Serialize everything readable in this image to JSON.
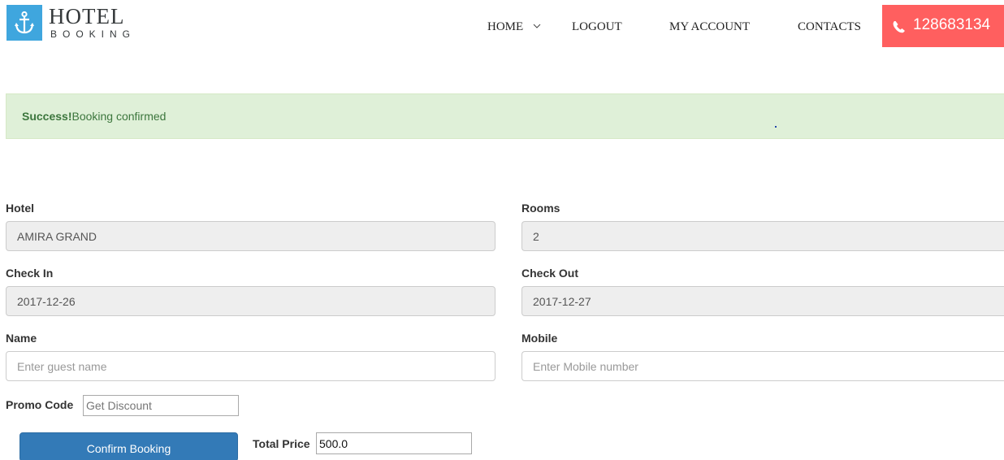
{
  "header": {
    "logo_title": "HOTEL",
    "logo_subtitle": "BOOKING",
    "nav": {
      "home": "HOME",
      "logout": "LOGOUT",
      "my_account": "MY ACCOUNT",
      "contacts": "CONTACTS"
    },
    "phone": "128683134",
    "icons": {
      "logo": "anchor-icon",
      "home_dropdown": "chevron-down-icon",
      "phone": "phone-icon"
    },
    "colors": {
      "logo_bg": "#3fa6de",
      "phone_bg": "#ff5f5f"
    }
  },
  "alert": {
    "strong": "Success!",
    "message": "Booking confirmed",
    "colors": {
      "bg": "#dff0d8",
      "text": "#3c763d"
    }
  },
  "form": {
    "hotel": {
      "label": "Hotel",
      "value": "AMIRA GRAND"
    },
    "rooms": {
      "label": "Rooms",
      "value": "2"
    },
    "check_in": {
      "label": "Check In",
      "value": "2017-12-26"
    },
    "check_out": {
      "label": "Check Out",
      "value": "2017-12-27"
    },
    "name": {
      "label": "Name",
      "placeholder": "Enter guest name"
    },
    "mobile": {
      "label": "Mobile",
      "placeholder": "Enter Mobile number"
    },
    "promo": {
      "label": "Promo Code",
      "placeholder": "Get Discount"
    },
    "confirm_label": "Confirm Booking",
    "total": {
      "label": "Total Price",
      "value": "500.0"
    },
    "colors": {
      "button": "#337ab7"
    }
  }
}
